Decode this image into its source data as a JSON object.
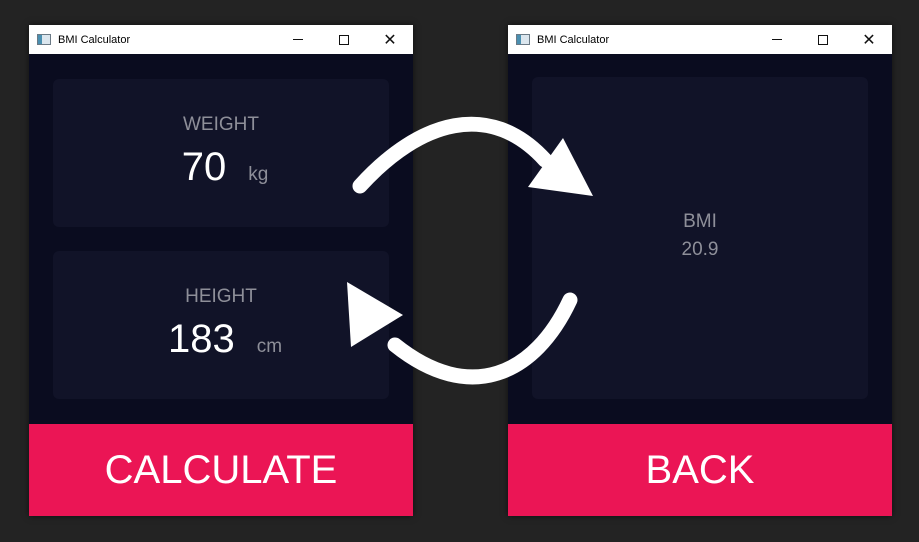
{
  "calculator_window": {
    "title": "BMI Calculator",
    "weight": {
      "label": "WEIGHT",
      "value": "70",
      "unit": "kg"
    },
    "height": {
      "label": "HEIGHT",
      "value": "183",
      "unit": "cm"
    },
    "calculate_label": "CALCULATE"
  },
  "result_window": {
    "title": "BMI Calculator",
    "bmi_label": "BMI",
    "bmi_value": "20.9",
    "back_label": "BACK"
  },
  "window_controls": {
    "minimize": "–",
    "maximize": "□",
    "close": "✕"
  },
  "colors": {
    "background": "#232323",
    "window_bg": "#0a0c1f",
    "card_bg": "#111328",
    "accent": "#eb1555",
    "label": "#8e8f99",
    "value": "#ffffff"
  }
}
